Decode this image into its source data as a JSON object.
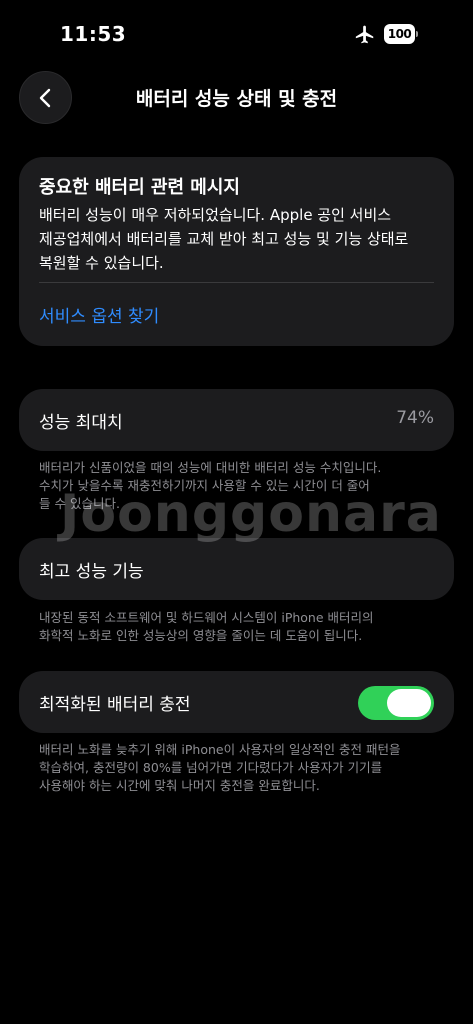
{
  "status_bar": {
    "time": "11:53",
    "battery_level": "100",
    "icons": [
      "airplane-icon",
      "battery-icon"
    ]
  },
  "nav": {
    "title": "배터리 성능 상태 및 충전",
    "back_icon": "chevron-left-icon"
  },
  "alert": {
    "title": "중요한 배터리 관련 메시지",
    "body_lines": [
      "배터리 성능이 매우 저하되었습니다. Apple 공인 서비스",
      "제공업체에서 배터리를 교체 받아 최고 성능 및 기능 상태로",
      "복원할 수 있습니다."
    ],
    "link": "서비스 옵션 찾기"
  },
  "max_capacity": {
    "label": "성능 최대치",
    "value": "74%",
    "footnote_lines": [
      "배터리가 신품이었을 때의 성능에 대비한 배터리 성능 수치입니다.",
      "수치가 낮을수록 재충전하기까지 사용할 수 있는 시간이 더 줄어",
      "들 수 있습니다."
    ]
  },
  "peak_performance": {
    "label": "최고 성능 기능",
    "footnote_lines": [
      "내장된 동적 소프트웨어 및 하드웨어 시스템이 iPhone 배터리의",
      "화학적 노화로 인한 성능상의 영향을 줄이는 데 도움이 됩니다."
    ]
  },
  "optimized_charging": {
    "label": "최적화된 배터리 충전",
    "enabled": true,
    "footnote_lines": [
      "배터리 노화를 늦추기 위해 iPhone이 사용자의 일상적인 충전 패턴을",
      "학습하여, 충전량이 80%를 넘어가면 기다렸다가 사용자가 기기를",
      "사용해야 하는 시간에 맞춰 나머지 충전을 완료합니다."
    ]
  },
  "watermark": "Joonggonara",
  "colors": {
    "background": "#000000",
    "card": "#1c1c1e",
    "link": "#2f8cff",
    "toggle_on": "#30d158",
    "secondary_text": "#8e8e93"
  }
}
